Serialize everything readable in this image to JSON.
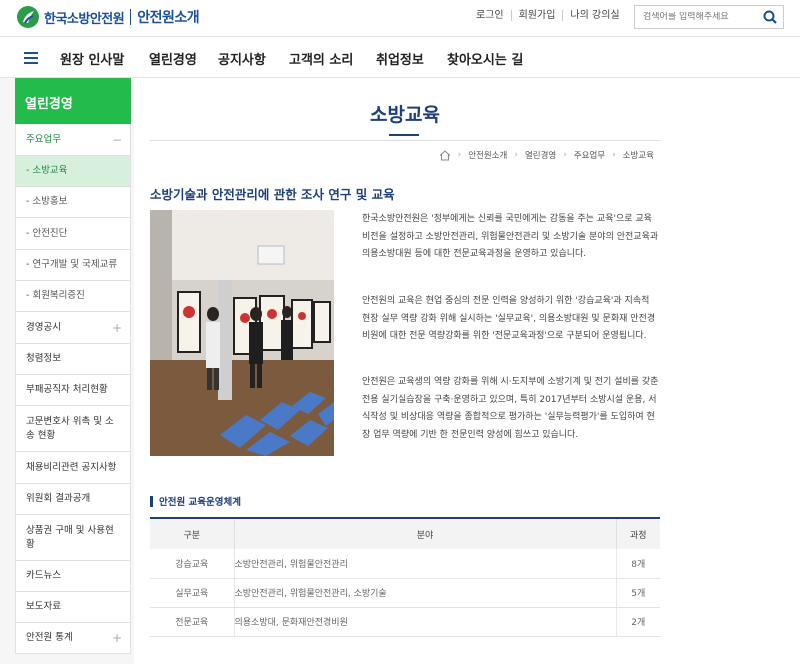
{
  "header": {
    "logo_text": "한국소방안전원",
    "logo_sub": "안전원소개",
    "links": [
      "로그인",
      "회원가입",
      "나의 강의실"
    ],
    "search_placeholder": "검색어를 입력해주세요"
  },
  "gnb": {
    "items": [
      "원장 인사말",
      "열린경영",
      "공지사항",
      "고객의 소리",
      "취업정보",
      "찾아오시는 길"
    ]
  },
  "lnb": {
    "title": "열린경영",
    "items": [
      {
        "label": "주요업무",
        "control": "−"
      },
      {
        "label": "- 소방교육"
      },
      {
        "label": "- 소방홍보"
      },
      {
        "label": "- 안전진단"
      },
      {
        "label": "- 연구개발 및 국제교류"
      },
      {
        "label": "- 회원복리증진"
      },
      {
        "label": "경영공시",
        "control": "+"
      },
      {
        "label": "청렴정보"
      },
      {
        "label": "부패공직자 처리현황"
      },
      {
        "label": "고문변호사 위촉 및 소송 현황"
      },
      {
        "label": "채용비리관련 공지사항"
      },
      {
        "label": "위원회 결과공개"
      },
      {
        "label": "상품권 구매 및 사용현황"
      },
      {
        "label": "카드뉴스"
      },
      {
        "label": "보도자료"
      },
      {
        "label": "안전원 통계",
        "control": "+"
      }
    ]
  },
  "content": {
    "page_title": "소방교육",
    "breadcrumb": [
      "안전원소개",
      "열린경영",
      "주요업무",
      "소방교육"
    ],
    "section_title": "소방기술과 안전관리에 관한 조사 연구 및 교육",
    "paragraphs": [
      "한국소방안전원은 '정부에게는 신뢰를 국민에게는 감동을 주는 교육'으로 교육 비전을 설정하고 소방안전관리, 위험물안전관리 및 소방기술 분야의 안전교육과 의용소방대원 등에 대한 전문교육과정을 운영하고 있습니다.",
      "안전원의 교육은 현업 중심의 전문 인력을 양성하기 위한 '강습교육'과 지속적 현장 실무 역량 강화 위해 실시하는 '실무교육', 의용소방대원 및 문화재 안전경비원에 대한 전문 역량강화를 위한 '전문교육과정'으로 구분되어 운영됩니다.",
      "안전원은 교육생의 역량 강화를 위해 시·도지부에 소방기계 및 전기 설비를 갖춘 전용 실기실습장을 구축·운영하고 있으며, 특히 2017년부터 소방시설 운용, 서식작성 및 비상대응 역량을 종합적으로 평가하는 '실무능력평가'를 도입하여 현장 업무 역량에 기반 한 전문인력 양성에 힘쓰고 있습니다."
    ],
    "table_title": "안전원 교육운영체계",
    "table": {
      "headers": [
        "구분",
        "분야",
        "과정"
      ],
      "rows": [
        [
          "강습교육",
          "소방안전관리, 위험물안전관리",
          "8개"
        ],
        [
          "실무교육",
          "소방안전관리, 위험물안전관리, 소방기술",
          "5개"
        ],
        [
          "전문교육",
          "의용소방대, 문화재안전경비원",
          "2개"
        ]
      ]
    }
  },
  "colors": {
    "brand": "#1d3f7c",
    "green": "#22bb4c",
    "active_bg": "#d6f0dd"
  }
}
